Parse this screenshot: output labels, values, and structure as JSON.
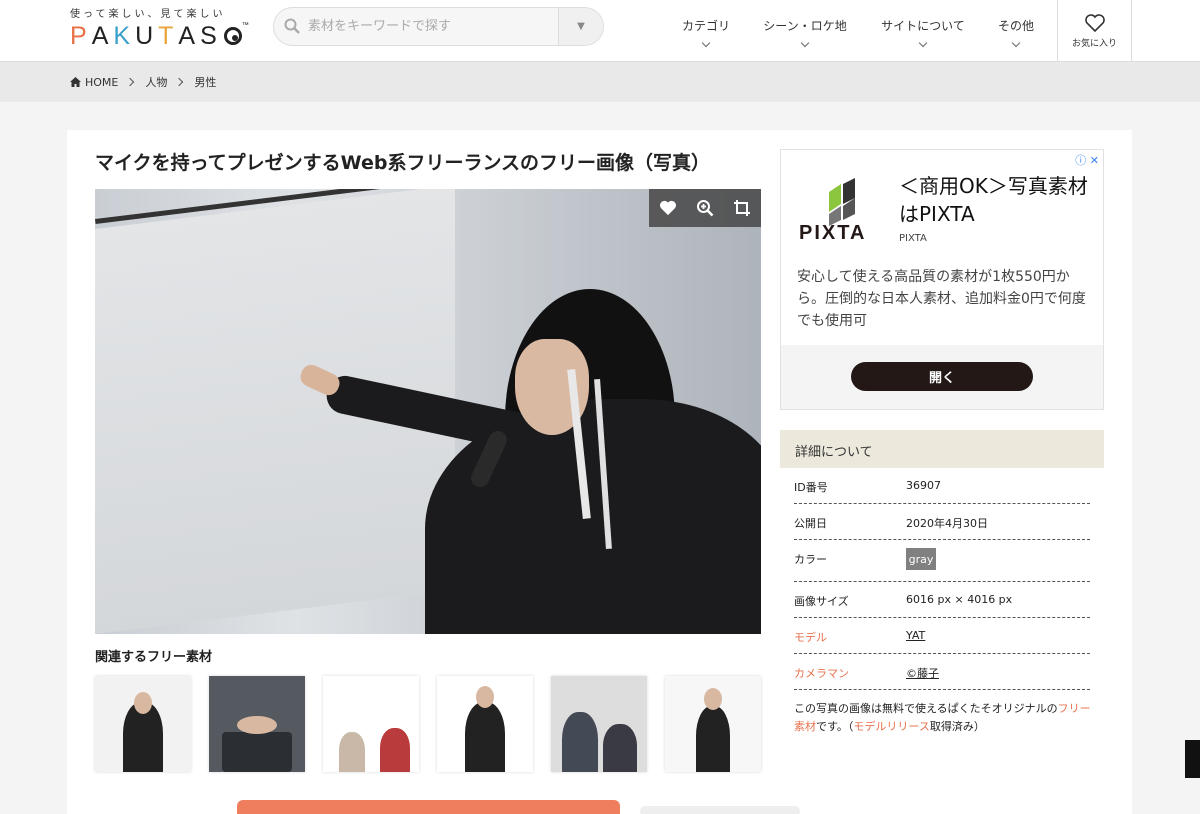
{
  "header": {
    "logo_tagline": "使って楽しい、見て楽しい",
    "logo_letters": [
      "P",
      "A",
      "K",
      "U",
      "T",
      "A",
      "S"
    ],
    "logo_letter_colors": [
      "#e87046",
      "#333333",
      "#3aa0c9",
      "#333333",
      "#e8a43a",
      "#333333",
      "#333333"
    ],
    "logo_tm": "™",
    "search_placeholder": "素材をキーワードで探す",
    "nav": [
      {
        "label": "カテゴリ"
      },
      {
        "label": "シーン・ロケ地"
      },
      {
        "label": "サイトについて"
      },
      {
        "label": "その他"
      }
    ],
    "favorites_label": "お気に入り"
  },
  "breadcrumb": {
    "home": "HOME",
    "items": [
      "人物",
      "男性"
    ]
  },
  "page_title": "マイクを持ってプレゼンするWeb系フリーランスのフリー画像（写真）",
  "related": {
    "heading": "関連するフリー素材",
    "count": 6
  },
  "ad": {
    "headline": "＜商用OK＞写真素材はPIXTA",
    "logo_text": "PIXTA",
    "brand": "PIXTA",
    "body": "安心して使える高品質の素材が1枚550円から。圧倒的な日本人素材、追加料金0円で何度でも使用可",
    "open_label": "開く",
    "info_icons": "ⓘ ✕"
  },
  "details": {
    "heading": "詳細について",
    "rows": [
      {
        "key": "ID番号",
        "value": "36907"
      },
      {
        "key": "公開日",
        "value": "2020年4月30日"
      },
      {
        "key": "カラー",
        "value": "gray"
      },
      {
        "key": "画像サイズ",
        "value": "6016 px × 4016 px"
      },
      {
        "key": "モデル",
        "value": "YAT"
      },
      {
        "key": "カメラマン",
        "value": "©藤子"
      }
    ],
    "note_prefix": "この写真の画像は無料で使えるぱくたそオリジナルの",
    "note_link1": "フリー素材",
    "note_mid": "です。（",
    "note_link2": "モデルリリース",
    "note_suffix": "取得済み）"
  },
  "colors": {
    "accent": "#e8734f",
    "ad_button": "#231815",
    "details_header": "#ece8dc"
  }
}
